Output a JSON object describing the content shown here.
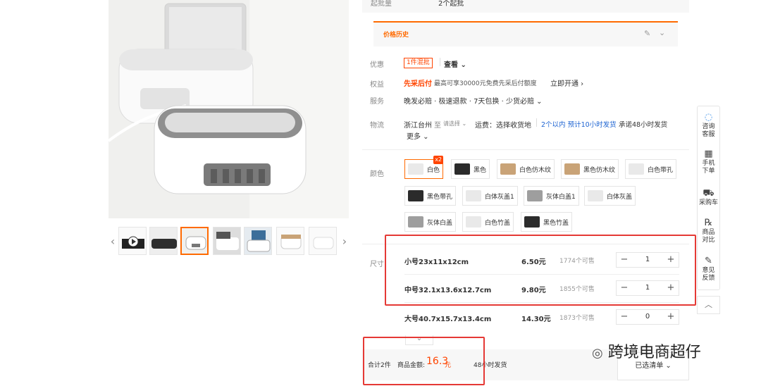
{
  "top": {
    "moq_label": "起批量",
    "moq_value": "2个起批"
  },
  "price_history": {
    "title": "价格历史"
  },
  "discount": {
    "label": "优惠",
    "badge": "1件混批",
    "link": "查看"
  },
  "rights": {
    "label": "权益",
    "tag": "先采后付",
    "desc": "最高可享30000元免费先采后付额度",
    "link": "立即开通"
  },
  "service": {
    "label": "服务",
    "text": "晚发必赔 · 极速退款 · 7天包换 · 少货必赔"
  },
  "logistics": {
    "label": "物流",
    "origin": "浙江台州",
    "to": "至",
    "select": "请选择",
    "fee": "运费：选择收货地",
    "promise": "2个以内 预计10小时发货",
    "commit": "承诺48小时发货",
    "more": "更多"
  },
  "color": {
    "label": "颜色",
    "badge": "x2",
    "options": [
      "白色",
      "黑色",
      "白色仿木纹",
      "黑色仿木纹",
      "白色带孔",
      "黑色带孔",
      "白体灰盖1",
      "灰体白盖1",
      "白体灰盖",
      "灰体白盖",
      "白色竹盖",
      "黑色竹盖"
    ],
    "swatches": {
      "white": "#e9e9e9",
      "black": "#2b2b2b",
      "wood": "#c9a377",
      "gray": "#9e9e9e"
    }
  },
  "size": {
    "label": "尺寸",
    "rows": [
      {
        "name": "小号23x11x12cm",
        "price": "6.50元",
        "stock": "1774个可售",
        "qty": "1"
      },
      {
        "name": "中号32.1x13.6x12.7cm",
        "price": "9.80元",
        "stock": "1855个可售",
        "qty": "1"
      },
      {
        "name": "大号40.7x15.7x13.4cm",
        "price": "14.30元",
        "stock": "1873个可售",
        "qty": "0"
      }
    ]
  },
  "footer": {
    "total_label": "合计2件",
    "amount_label": "商品金额:",
    "amount": "16.3",
    "unit": "元",
    "ship": "48小时发货",
    "list_btn": "已选清单"
  },
  "tools": [
    {
      "icon": "chat-icon",
      "label": "咨询\n客服"
    },
    {
      "icon": "qr-icon",
      "label": "手机\n下单"
    },
    {
      "icon": "cart-icon",
      "label": "采购车"
    },
    {
      "icon": "compare-icon",
      "label": "商品\n对比"
    },
    {
      "icon": "feedback-icon",
      "label": "意见\n反馈"
    }
  ],
  "watermark": "跨境电商超仔",
  "colors": {
    "accent": "#ff6a00",
    "red": "#ff4400",
    "blue": "#1e64d2",
    "annotation": "#e53935"
  }
}
